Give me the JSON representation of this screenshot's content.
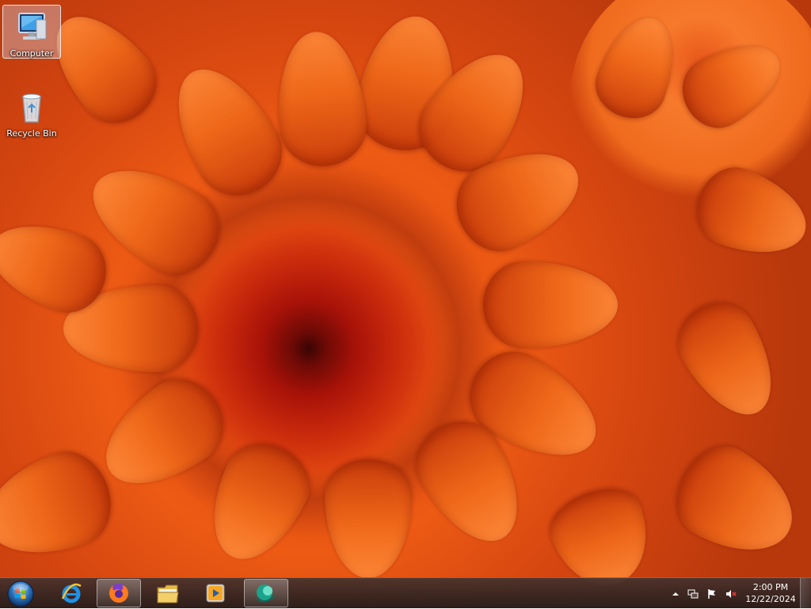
{
  "desktop": {
    "wallpaper": "orange chrysanthemum flower",
    "icons": [
      {
        "label": "Computer",
        "icon": "computer-icon",
        "selected": true
      },
      {
        "label": "Recycle Bin",
        "icon": "recycle-bin-icon",
        "selected": false
      }
    ]
  },
  "taskbar": {
    "start_icon": "windows-start-orb-icon",
    "pinned": [
      {
        "name": "Internet Explorer",
        "icon": "internet-explorer-icon",
        "active": false
      },
      {
        "name": "Firefox",
        "icon": "firefox-icon",
        "active": true
      },
      {
        "name": "Windows Explorer",
        "icon": "folder-icon",
        "active": false
      },
      {
        "name": "Windows Media Player",
        "icon": "media-player-icon",
        "active": false
      },
      {
        "name": "App",
        "icon": "app-icon",
        "active": true
      }
    ],
    "tray": {
      "icons": [
        "show-hidden-icons-arrow-icon",
        "network-icon",
        "action-center-flag-icon",
        "volume-muted-icon"
      ],
      "time": "2:00 PM",
      "date": "12/22/2024"
    }
  },
  "colors": {
    "wallpaper_primary": "#e8521a",
    "wallpaper_center": "#a81208",
    "taskbar_bg": "#3a2a26"
  }
}
